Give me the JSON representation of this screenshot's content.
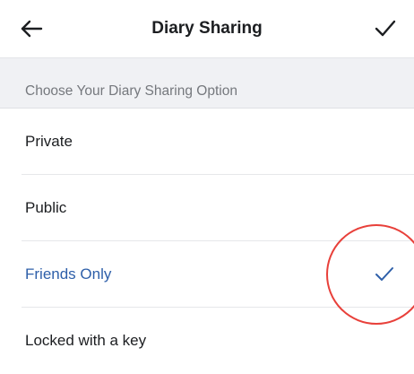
{
  "header": {
    "back_icon": "arrow-left-icon",
    "title": "Diary Sharing",
    "done_icon": "checkmark-icon"
  },
  "section": {
    "title": "Choose Your Diary Sharing Option"
  },
  "options": [
    {
      "label": "Private",
      "selected": false
    },
    {
      "label": "Public",
      "selected": false
    },
    {
      "label": "Friends Only",
      "selected": true
    },
    {
      "label": "Locked with a key",
      "selected": false
    }
  ],
  "colors": {
    "accent": "#2e5fa9",
    "annotation": "#e8403a"
  }
}
